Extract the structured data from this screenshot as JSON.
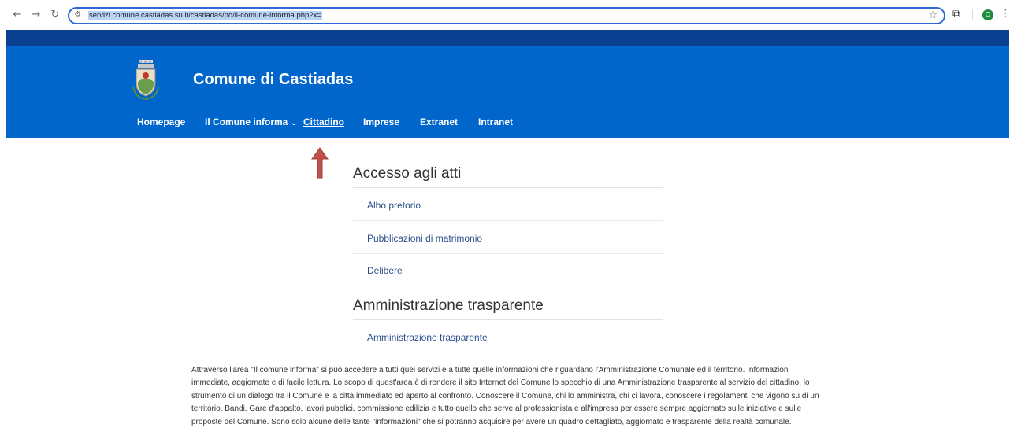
{
  "browser": {
    "url": "servizi.comune.castiadas.su.it/castiadas/po/il-comune-informa.php?x=",
    "back_icon": "back-arrow-icon",
    "forward_icon": "forward-arrow-icon",
    "reload_icon": "reload-icon",
    "profile_initial": "O",
    "accent_color": "#2d6ad6"
  },
  "site": {
    "title": "Comune di Castiadas",
    "header_color": "#0066cc",
    "topbar_color": "#0b3f8f",
    "nav": [
      {
        "label": "Homepage"
      },
      {
        "label": "Il Comune informa"
      },
      {
        "label": "Cittadino"
      },
      {
        "label": "Imprese"
      },
      {
        "label": "Extranet"
      },
      {
        "label": "Intranet"
      }
    ]
  },
  "sections": [
    {
      "title": "Accesso agli atti",
      "links": [
        "Albo pretorio",
        "Pubblicazioni di matrimonio",
        "Delibere"
      ]
    },
    {
      "title": "Amministrazione trasparente",
      "links": [
        "Amministrazione trasparente"
      ]
    }
  ],
  "description": "Attraverso l'area \"Il comune informa\" si può accedere a tutti quei servizi e a tutte quelle informazioni che riguardano l'Amministrazione Comunale ed il territorio. Informazioni immediate, aggiornate e di facile lettura. Lo scopo di quest'area è di rendere il sito Internet del Comune lo specchio di una Amministrazione trasparente al servizio del cittadino, lo strumento di un dialogo tra il Comune e la città immediato ed aperto al confronto. Conoscere il Comune, chi lo amministra, chi ci lavora, conoscere i regolamenti che vigono su di un territorio, Bandi, Gare d'appalto, lavori pubblici, commissione edilizia e tutto quello che serve al professionista e all'impresa per essere sempre aggiornato sulle iniziative e sulle proposte del Comune. Sono solo alcune delle tante \"informazioni\" che si potranno acquisire per avere un quadro dettagliato, aggiornato e trasparente della realtà comunale."
}
